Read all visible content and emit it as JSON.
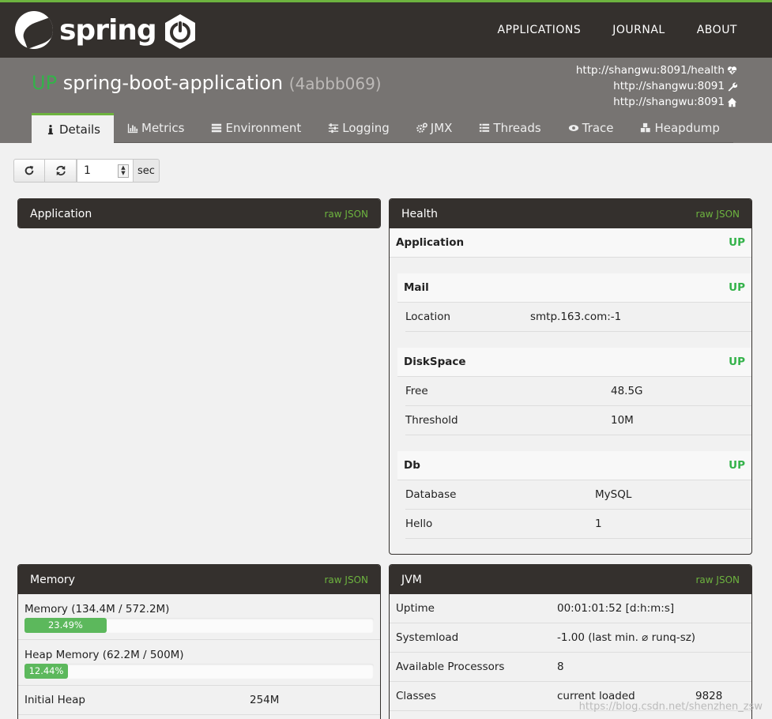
{
  "nav": {
    "brand": "spring",
    "links": [
      "APPLICATIONS",
      "JOURNAL",
      "ABOUT"
    ]
  },
  "app": {
    "status": "UP",
    "name": "spring-boot-application",
    "id": "(4abbb069)",
    "health_url": "http://shangwu:8091/health",
    "mgmt_url": "http://shangwu:8091",
    "service_url": "http://shangwu:8091"
  },
  "tabs": [
    {
      "label": "Details",
      "icon": "info-icon"
    },
    {
      "label": "Metrics",
      "icon": "bar-chart-icon"
    },
    {
      "label": "Environment",
      "icon": "server-icon"
    },
    {
      "label": "Logging",
      "icon": "sliders-icon"
    },
    {
      "label": "JMX",
      "icon": "cogs-icon"
    },
    {
      "label": "Threads",
      "icon": "list-icon"
    },
    {
      "label": "Trace",
      "icon": "eye-icon"
    },
    {
      "label": "Heapdump",
      "icon": "cubes-icon"
    }
  ],
  "refresh": {
    "interval": "1",
    "unit": "sec"
  },
  "application_panel": {
    "title": "Application",
    "raw": "raw JSON"
  },
  "health": {
    "title": "Health",
    "raw": "raw JSON",
    "app_label": "Application",
    "app_status": "UP",
    "mail": {
      "label": "Mail",
      "status": "UP",
      "location_key": "Location",
      "location_val": "smtp.163.com:-1"
    },
    "disk": {
      "label": "DiskSpace",
      "status": "UP",
      "free_key": "Free",
      "free_val": "48.5G",
      "threshold_key": "Threshold",
      "threshold_val": "10M"
    },
    "db": {
      "label": "Db",
      "status": "UP",
      "database_key": "Database",
      "database_val": "MySQL",
      "hello_key": "Hello",
      "hello_val": "1"
    }
  },
  "memory": {
    "title": "Memory",
    "raw": "raw JSON",
    "mem_label": "Memory (134.4M / 572.2M)",
    "mem_percent": 23.49,
    "mem_percent_text": "23.49%",
    "heap_label": "Heap Memory (62.2M / 500M)",
    "heap_percent": 12.44,
    "heap_percent_text": "12.44%",
    "initial_heap_key": "Initial Heap",
    "initial_heap_val": "254M"
  },
  "jvm": {
    "title": "JVM",
    "raw": "raw JSON",
    "uptime_key": "Uptime",
    "uptime_val": "00:01:01:52 [d:h:m:s]",
    "load_key": "Systemload",
    "load_val": "-1.00 (last min. ⌀ runq-sz)",
    "cpu_key": "Available Processors",
    "cpu_val": "8",
    "classes_key": "Classes",
    "classes_sub": "current loaded",
    "classes_val": "9828"
  },
  "watermark": "https://blog.csdn.net/shenzhen_zsw",
  "colors": {
    "brand_green": "#6db33f",
    "status_up": "#34b24a",
    "nav_bg": "#34302d",
    "header_bg": "#777472",
    "progress": "#5cb85c"
  }
}
